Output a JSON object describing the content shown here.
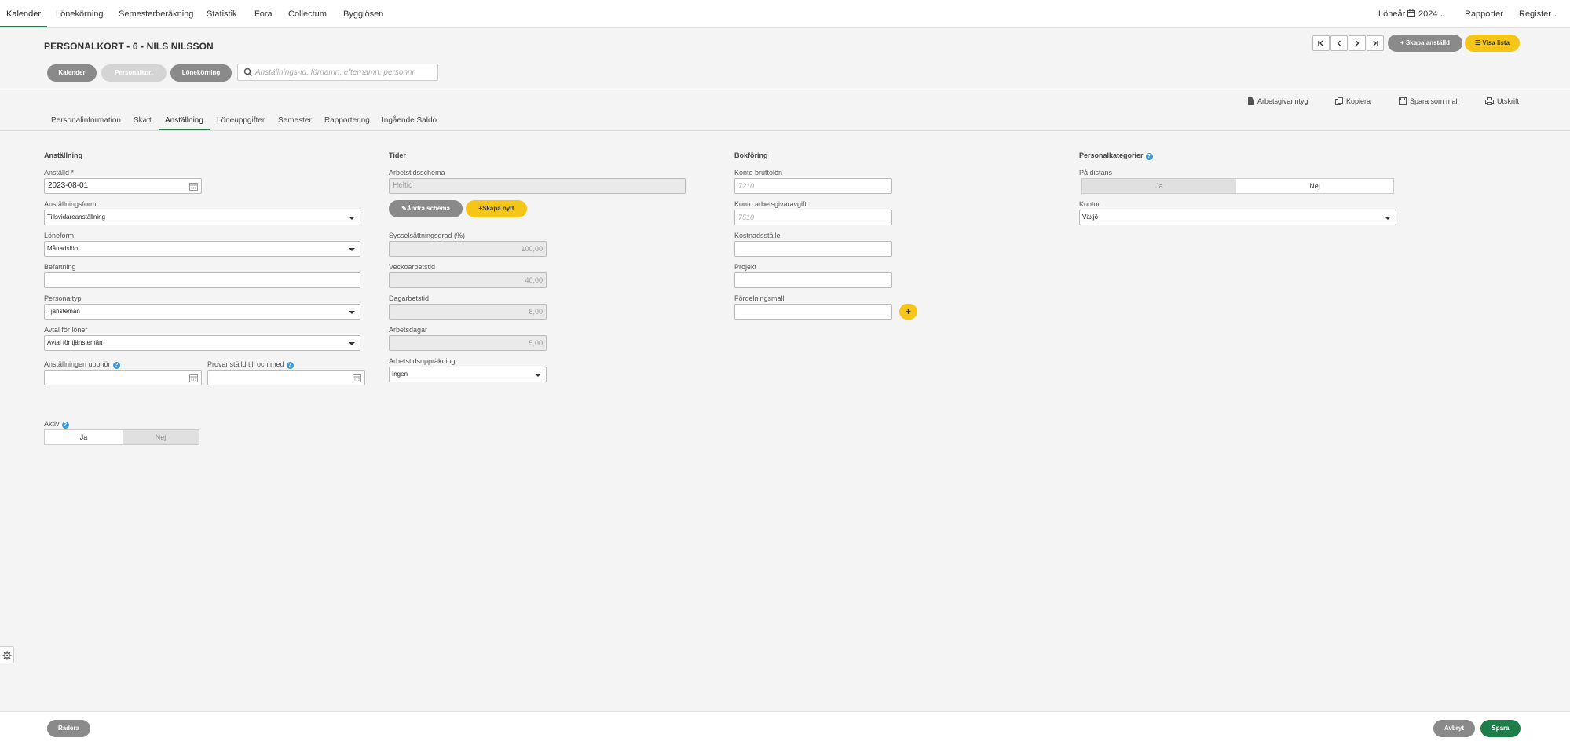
{
  "topnav": {
    "items": [
      "Kalender",
      "Lönekörning",
      "Semesterberäkning",
      "Statistik",
      "Fora",
      "Collectum",
      "Bygglösen"
    ],
    "loneår_label": "Löneår",
    "year": "2024",
    "rapporter": "Rapporter",
    "register": "Register"
  },
  "header": {
    "title": "PERSONALKORT - 6 - NILS NILSSON",
    "btn_kalender": "Kalender",
    "btn_personalkort": "Personalkort",
    "btn_lonekorning": "Lönekörning",
    "search_placeholder": "Anställnings-id, förnamn, efternamn, personnr",
    "btn_skapa_anstalld": "Skapa anställd",
    "btn_visa_lista": "Visa lista"
  },
  "actions": {
    "arbetsgivarintyg": "Arbetsgivarintyg",
    "kopiera": "Kopiera",
    "spara_som_mall": "Spara som mall",
    "utskrift": "Utskrift"
  },
  "tabs": [
    "Personalinformation",
    "Skatt",
    "Anställning",
    "Löneuppgifter",
    "Semester",
    "Rapportering",
    "Ingående Saldo"
  ],
  "anstallning": {
    "title": "Anställning",
    "anstalld_label": "Anställd *",
    "anstalld_value": "2023-08-01",
    "anstallningsform_label": "Anställningsform",
    "anstallningsform_value": "Tillsvidareanställning",
    "loneform_label": "Löneform",
    "loneform_value": "Månadslön",
    "befattning_label": "Befattning",
    "befattning_value": "",
    "personaltyp_label": "Personaltyp",
    "personaltyp_value": "Tjänsteman",
    "avtal_label": "Avtal för löner",
    "avtal_value": "Avtal för tjänstemän",
    "upphor_label": "Anställningen upphör",
    "provanstalld_label": "Provanställd till och med",
    "aktiv_label": "Aktiv",
    "aktiv_ja": "Ja",
    "aktiv_nej": "Nej"
  },
  "tider": {
    "title": "Tider",
    "schema_label": "Arbetstidsschema",
    "schema_value": "Heltid",
    "btn_andra": "Ändra schema",
    "btn_skapa": "Skapa nytt",
    "syssel_label": "Sysselsättningsgrad (%)",
    "syssel_value": "100,00",
    "vecko_label": "Veckoarbetstid",
    "vecko_value": "40,00",
    "dag_label": "Dagarbetstid",
    "dag_value": "8,00",
    "arbetsdagar_label": "Arbetsdagar",
    "arbetsdagar_value": "5,00",
    "upprakning_label": "Arbetstidsuppräkning",
    "upprakning_value": "Ingen"
  },
  "bokforing": {
    "title": "Bokföring",
    "brutto_label": "Konto bruttolön",
    "brutto_placeholder": "7210",
    "avgift_label": "Konto arbetsgivaravgift",
    "avgift_placeholder": "7510",
    "kostnad_label": "Kostnadsställe",
    "projekt_label": "Projekt",
    "fordelning_label": "Fördelningsmall"
  },
  "personalkategorier": {
    "title": "Personalkategorier",
    "distans_label": "På distans",
    "distans_ja": "Ja",
    "distans_nej": "Nej",
    "kontor_label": "Kontor",
    "kontor_value": "Växjö"
  },
  "footer": {
    "radera": "Radera",
    "avbryt": "Avbryt",
    "spara": "Spara"
  },
  "colors": {
    "accent_green": "#1e7e4a",
    "accent_yellow": "#f5c518",
    "pill_gray": "#8a8a8a",
    "help_blue": "#3a9ad9"
  }
}
